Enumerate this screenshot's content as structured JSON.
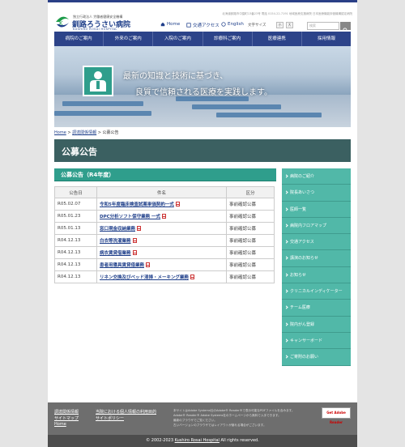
{
  "header": {
    "org_line": "独立行政法人 労働者健康安全機構",
    "hospital_name": "釧路ろうさい病院",
    "hospital_name_en": "KUSHIRO ROSAI HOSPITAL",
    "top_links": "北海道釧路市中園町13番23号  電話 0154-22-7191  地域医療支援病院  日本医療機能評価機構認定病院",
    "home_label": "Home",
    "access_label": "交通アクセス",
    "english_label": "English",
    "font_size_label": "文字サイズ",
    "font_small": "小",
    "font_large": "大",
    "search_placeholder": "検索"
  },
  "gnav": [
    "病院のご案内",
    "外来のご案内",
    "入院のご案内",
    "診療科ご案内",
    "医療連携",
    "採用情報"
  ],
  "hero": {
    "line1": "最新の知識と技術に基づき、",
    "line2": "良質で信頼される医療を実践します。"
  },
  "breadcrumb": {
    "home": "Home",
    "parent": "調達関係情報",
    "current": "公募公告"
  },
  "page_title": "公募公告",
  "section_title": "公募公告（R4年度）",
  "table": {
    "headers": [
      "公告日",
      "件名",
      "区分"
    ],
    "rows": [
      {
        "date": "R05.02.07",
        "name": "令和5年度臨床検査試薬単価契約一式",
        "type": "事前確認公募"
      },
      {
        "date": "R05.01.23",
        "name": "DPC分析ソフト保守業務 一式",
        "type": "事前確認公募"
      },
      {
        "date": "R05.01.13",
        "name": "窓口現金収納業務",
        "type": "事前確認公募"
      },
      {
        "date": "R04.12.13",
        "name": "白衣等洗濯業務",
        "type": "事前確認公募"
      },
      {
        "date": "R04.12.13",
        "name": "病衣賃貸借業務",
        "type": "事前確認公募"
      },
      {
        "date": "R04.12.13",
        "name": "患者用寝具賃貸借業務",
        "type": "事前確認公募"
      },
      {
        "date": "R04.12.13",
        "name": "リネン交換及びベッド清掃・メーキング業務",
        "type": "事前確認公募"
      }
    ]
  },
  "side_nav": [
    "病院のご紹介",
    "院長あいさつ",
    "医師一覧",
    "病院内フロアマップ",
    "交通アクセス",
    "講演のお知らせ",
    "お知らせ",
    "クリニカルインディケーター",
    "チーム医療",
    "院内がん登録",
    "キャンサーボード",
    "ご寄附のお願い"
  ],
  "footer": {
    "col1": [
      "調達関係情報",
      "サイトマップ",
      "Home"
    ],
    "col2": [
      "当院における個人情報の利用目的",
      "サイトポリシー"
    ],
    "notes": [
      "本サイトはAdobe Systems社のAdobe® Reader®で表示可能なPDFファイルを含みます。",
      "Adobe® Reader® Adobe Systems社のホームページから無料で入手できます。",
      "最新のブラウザでご覧ください。",
      "古いバージョンのブラウザではレイアウトが崩れる場合がございます。"
    ],
    "adobe_badge": "Get Adobe Reader",
    "copyright_prefix": "© 2002-2023",
    "copyright_link": "Kushiro Rosai Hospital",
    "copyright_suffix": "All rights reserved."
  },
  "colors": {
    "brand_navy": "#2c4389",
    "accent_teal": "#2f9e8c",
    "title_band": "#3b6061",
    "side_nav": "#51b8a8"
  }
}
